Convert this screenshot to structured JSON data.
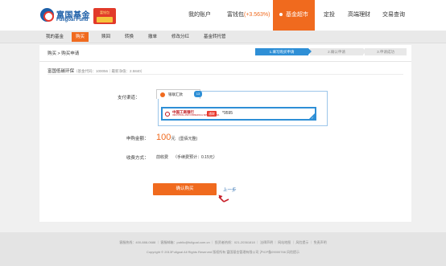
{
  "header": {
    "logo_cn": "富国基金",
    "logo_en": "Fullgoal Fund",
    "badge_text": "富钱包",
    "nav": [
      {
        "label": "我的账户"
      },
      {
        "label": "富钱包",
        "rate": "(+3.563%)"
      },
      {
        "label": "基金超市"
      },
      {
        "label": "定投"
      },
      {
        "label": "高端理财"
      },
      {
        "label": "交易查询"
      }
    ]
  },
  "subnav": [
    "我的基金",
    "购买",
    "赎回",
    "转换",
    "撤单",
    "修改分红",
    "基金转托管"
  ],
  "breadcrumb": "购买 > 购买申请",
  "steps": [
    "1.填写购买申请",
    "2.确认申请",
    "3.申请成功"
  ],
  "fund": {
    "name": "富国低碳环保",
    "meta": "（基金代码：100056｜最新净值：2.5840）"
  },
  "payment": {
    "label": "支付渠道：",
    "tab_label": "银联汇款",
    "tab_badge": "13",
    "bank_name": "中国工商银行",
    "bank_sub": "INDUSTRIAL AND COMMERCIAL BANK OF CHINA",
    "bank_tag": "通联",
    "card_tail": "*9595"
  },
  "amount": {
    "label": "申购金额：",
    "value": "100",
    "unit": "元",
    "hint": "(壹佰元整)"
  },
  "fee": {
    "label": "收费方式：",
    "value": "前收费",
    "estimate": "（手续费预计：0.15元）"
  },
  "actions": {
    "confirm": "确认购买",
    "prev": "上一步"
  },
  "footer": {
    "line1": "客服热线：400-888-0688 ｜ 客服邮箱：public@fullgoal.com.cn ｜ 投资者热线：021-20361818 ｜ 法律声明 ｜ 网站地图 ｜ 风险提示 ｜ 免责声明",
    "line2": "Copyright © 2013Fullgoal All Rights Reserved 版权所有 富国基金管理有限公司 沪ICP备09000766 风险提示"
  },
  "colors": {
    "accent": "#f06a1e",
    "blue": "#2e8fd6"
  }
}
